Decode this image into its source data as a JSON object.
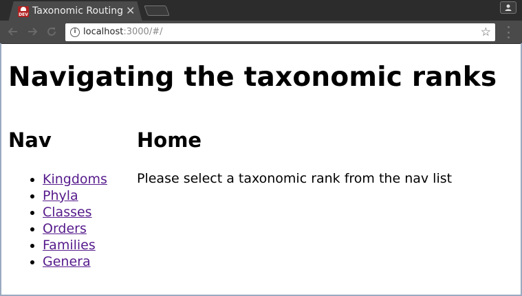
{
  "browser": {
    "tab_title": "Taxonomic Routing",
    "tab_close": "✕",
    "favicon_text": "DEV",
    "url_host": "localhost",
    "url_rest": ":3000/#/",
    "icons": [
      "back-arrow-icon",
      "forward-arrow-icon",
      "reload-icon",
      "info-icon",
      "star-icon",
      "kebab-menu-icon",
      "profile-icon"
    ]
  },
  "page": {
    "title": "Navigating the taxonomic ranks",
    "nav_heading": "Nav",
    "nav_items": [
      {
        "label": "Kingdoms"
      },
      {
        "label": "Phyla"
      },
      {
        "label": "Classes"
      },
      {
        "label": "Orders"
      },
      {
        "label": "Families"
      },
      {
        "label": "Genera"
      }
    ],
    "home_heading": "Home",
    "home_text": "Please select a taxonomic rank from the nav list"
  },
  "colors": {
    "chrome_dark": "#2c2c2c",
    "toolbar": "#4a4a4a",
    "visited_link": "#551a8b"
  }
}
